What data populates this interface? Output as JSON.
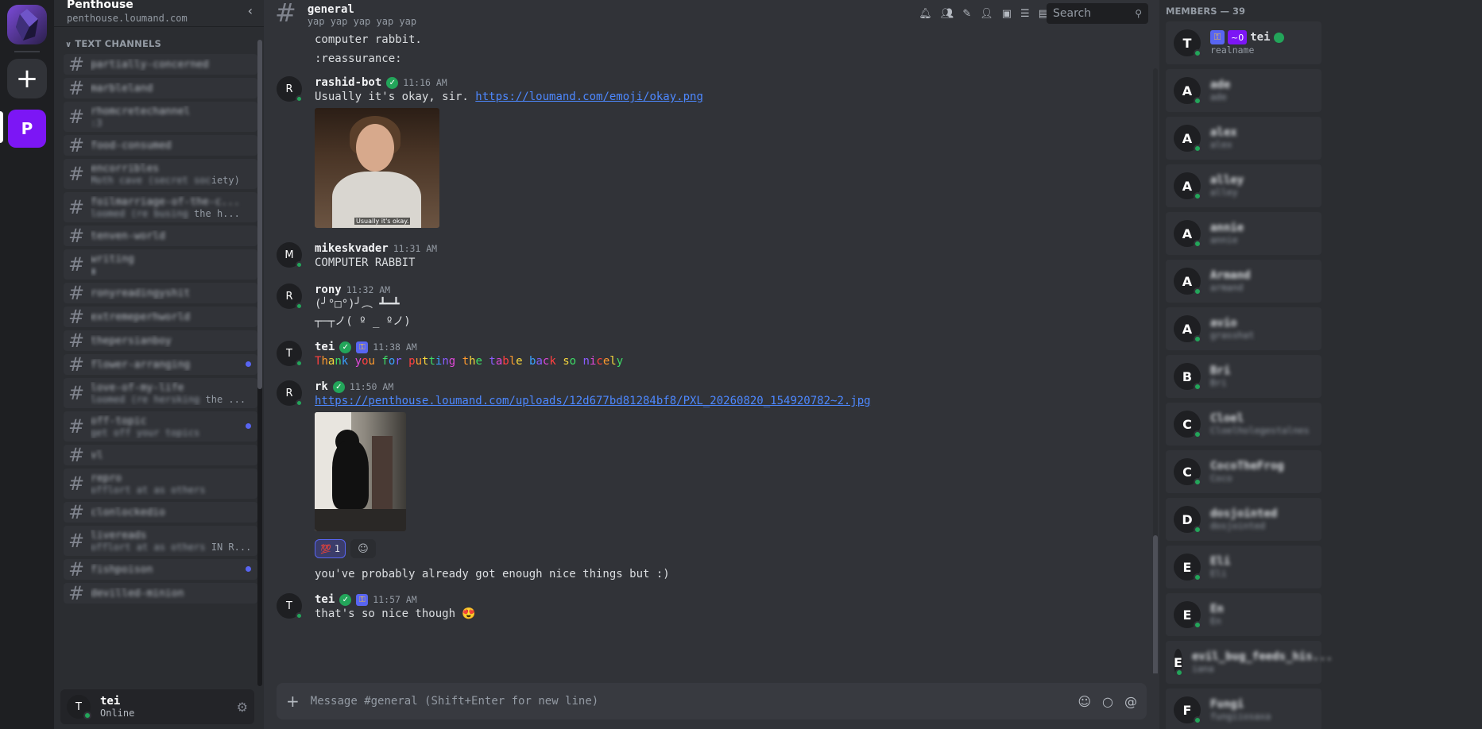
{
  "guild": {
    "name": "Penthouse",
    "host": "penthouse.loumand.com"
  },
  "rail": {
    "server_initial": "P",
    "add_symbol": "+"
  },
  "sidebar": {
    "category": "TEXT CHANNELS",
    "channels": [
      {
        "name": "partially-concerned",
        "topic": ""
      },
      {
        "name": "marbleland",
        "topic": ""
      },
      {
        "name": "rhomcretechannel",
        "topic": ":3"
      },
      {
        "name": "food-consumed",
        "topic": ""
      },
      {
        "name": "encorribles",
        "topic_blur": "Moth cave (secret soc",
        "topic_tail": "iety)"
      },
      {
        "name": "foilmarriage-of-the-c...",
        "topic_blur": "loomed (re busing",
        "topic_tail": " the h..."
      },
      {
        "name": "tenven-world",
        "topic": ""
      },
      {
        "name": "writing",
        "topic": "▮"
      },
      {
        "name": "ronyreadingyshit",
        "topic": ""
      },
      {
        "name": "extremeperhworld",
        "topic": ""
      },
      {
        "name": "thepersianboy",
        "topic": ""
      },
      {
        "name": "flower-arranging",
        "topic": "",
        "unread": true
      },
      {
        "name": "love-of-my-life",
        "topic_blur": "loomed (re hersking",
        "topic_tail": " the ..."
      },
      {
        "name": "off-topic",
        "topic": "get off your topics",
        "unread": true
      },
      {
        "name": "vl",
        "topic": ""
      },
      {
        "name": "repro",
        "topic": "offlort at as others"
      },
      {
        "name": "clonlockedio",
        "topic": ""
      },
      {
        "name": "livereads",
        "topic_blur": "offlort at as others",
        "topic_tail": " IN R..."
      },
      {
        "name": "fishpoison",
        "topic": "",
        "unread": true
      },
      {
        "name": "devilled-minion",
        "topic": ""
      }
    ]
  },
  "user_panel": {
    "initial": "T",
    "name": "tei",
    "status": "Online"
  },
  "header": {
    "channel": "general",
    "topic": "yap yap yap yap yap",
    "search_placeholder": "Search"
  },
  "messages": {
    "prev_line_1": "computer rabbit.",
    "prev_line_2": ":reassurance:",
    "m1": {
      "initial": "R",
      "author": "rashid-bot",
      "time": "11:16 AM",
      "text": "Usually it's okay, sir. ",
      "link": "https://loumand.com/emoji/okay.png",
      "image_caption": "Usually it's okay."
    },
    "m2": {
      "initial": "M",
      "author": "mikeskvader",
      "time": "11:31 AM",
      "text": "COMPUTER RABBIT"
    },
    "m3": {
      "initial": "R",
      "author": "rony",
      "time": "11:32 AM",
      "line1": "(╯°□°)╯︵ ┻━┻",
      "line2": "┬─┬ノ( º _ ºノ)"
    },
    "m4": {
      "initial": "T",
      "author": "tei",
      "time": "11:38 AM",
      "rainbow_text": "Thank you for putting the table back so nicely"
    },
    "m5": {
      "initial": "R",
      "author": "rk",
      "time": "11:50 AM",
      "link": "https://penthouse.loumand.com/uploads/12d677bd81284bf8/PXL_20260820_154920782~2.jpg",
      "reaction_emoji": "💯",
      "reaction_count": "1",
      "followup": "you've probably already got enough nice things but :)"
    },
    "m6": {
      "initial": "T",
      "author": "tei",
      "time": "11:57 AM",
      "text": "that's so nice though 😍"
    }
  },
  "composer": {
    "placeholder": "Message #general (Shift+Enter for new line)"
  },
  "members": {
    "header": "MEMBERS — 39",
    "list": [
      {
        "initial": "T",
        "name": "tei",
        "sub": "realname",
        "me": true,
        "tilde": "~0"
      },
      {
        "initial": "A",
        "name": "ade",
        "sub": "ade"
      },
      {
        "initial": "A",
        "name": "alex",
        "sub": "alex"
      },
      {
        "initial": "A",
        "name": "alley",
        "sub": "alley"
      },
      {
        "initial": "A",
        "name": "annie",
        "sub": "annie"
      },
      {
        "initial": "A",
        "name": "Armand",
        "sub": "armand"
      },
      {
        "initial": "A",
        "name": "avio",
        "sub": "grasshat"
      },
      {
        "initial": "B",
        "name": "Bri",
        "sub": "Bri"
      },
      {
        "initial": "C",
        "name": "Cloel",
        "sub": "Cloelholegestalnes"
      },
      {
        "initial": "C",
        "name": "CocoTheFrog",
        "sub": "Coco"
      },
      {
        "initial": "D",
        "name": "dosjointed",
        "sub": "dosjointed"
      },
      {
        "initial": "E",
        "name": "Eli",
        "sub": "Eli"
      },
      {
        "initial": "E",
        "name": "En",
        "sub": "En"
      },
      {
        "initial": "E",
        "name": "evil_bug_feeds_his...",
        "sub": "iana"
      },
      {
        "initial": "F",
        "name": "Fungi",
        "sub": "fungiiosaxa"
      }
    ]
  },
  "colors": {
    "accent": "#5865f2",
    "online": "#23a55a",
    "brand": "#7c16f5",
    "link": "#4d88ff"
  }
}
